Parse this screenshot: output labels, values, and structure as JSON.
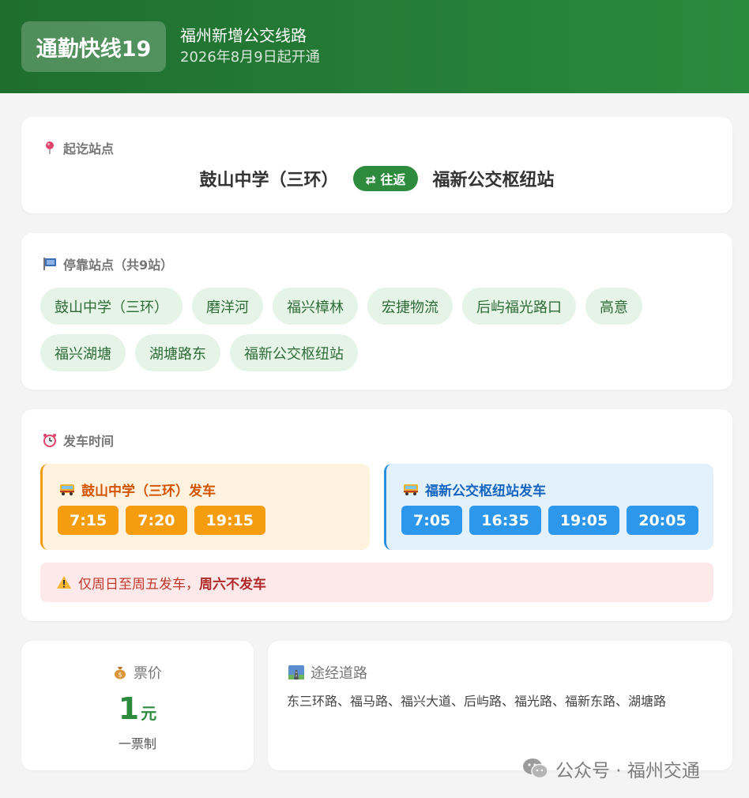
{
  "header": {
    "route_name": "通勤快线19",
    "subtitle": "福州新增公交线路",
    "open_date": "2026年8月9日起开通"
  },
  "terminals": {
    "title": "起讫站点",
    "origin": "鼓山中学（三环）",
    "direction_badge": "⇄ 往返",
    "destination": "福新公交枢纽站"
  },
  "stops": {
    "title": "停靠站点（共9站）",
    "items": [
      "鼓山中学（三环）",
      "磨洋河",
      "福兴樟林",
      "宏捷物流",
      "后屿福光路口",
      "高意",
      "福兴湖塘",
      "湖塘路东",
      "福新公交枢纽站"
    ]
  },
  "schedule": {
    "title": "发车时间",
    "from_origin": {
      "label": "鼓山中学（三环）发车",
      "times": [
        "7:15",
        "7:20",
        "19:15"
      ]
    },
    "from_destination": {
      "label": "福新公交枢纽站发车",
      "times": [
        "7:05",
        "16:35",
        "19:05",
        "20:05"
      ]
    },
    "notice_prefix": "仅周日至周五发车，",
    "notice_bold": "周六不发车"
  },
  "fare": {
    "title": "票价",
    "amount": "1",
    "unit": "元",
    "note": "一票制"
  },
  "roads": {
    "title": "途经道路",
    "text": "东三环路、福马路、福兴大道、后屿路、福光路、福新东路、湖塘路"
  },
  "watermark": {
    "text": "公众号 · 福州交通"
  },
  "colors": {
    "header_start": "#1f6e2e",
    "header_end": "#2a8a3e",
    "accent_green": "#2e8b3e",
    "orange": "#f59c0f",
    "blue": "#2d97eb",
    "warning_red": "#c0392b"
  },
  "icons": {
    "terminals": "pin-icon",
    "stops": "bus-stop-sign-icon",
    "schedule": "alarm-clock-icon",
    "bus": "bus-icon",
    "warning": "warning-icon",
    "fare": "money-bag-icon",
    "roads": "road-icon",
    "watermark": "wechat-icon"
  }
}
